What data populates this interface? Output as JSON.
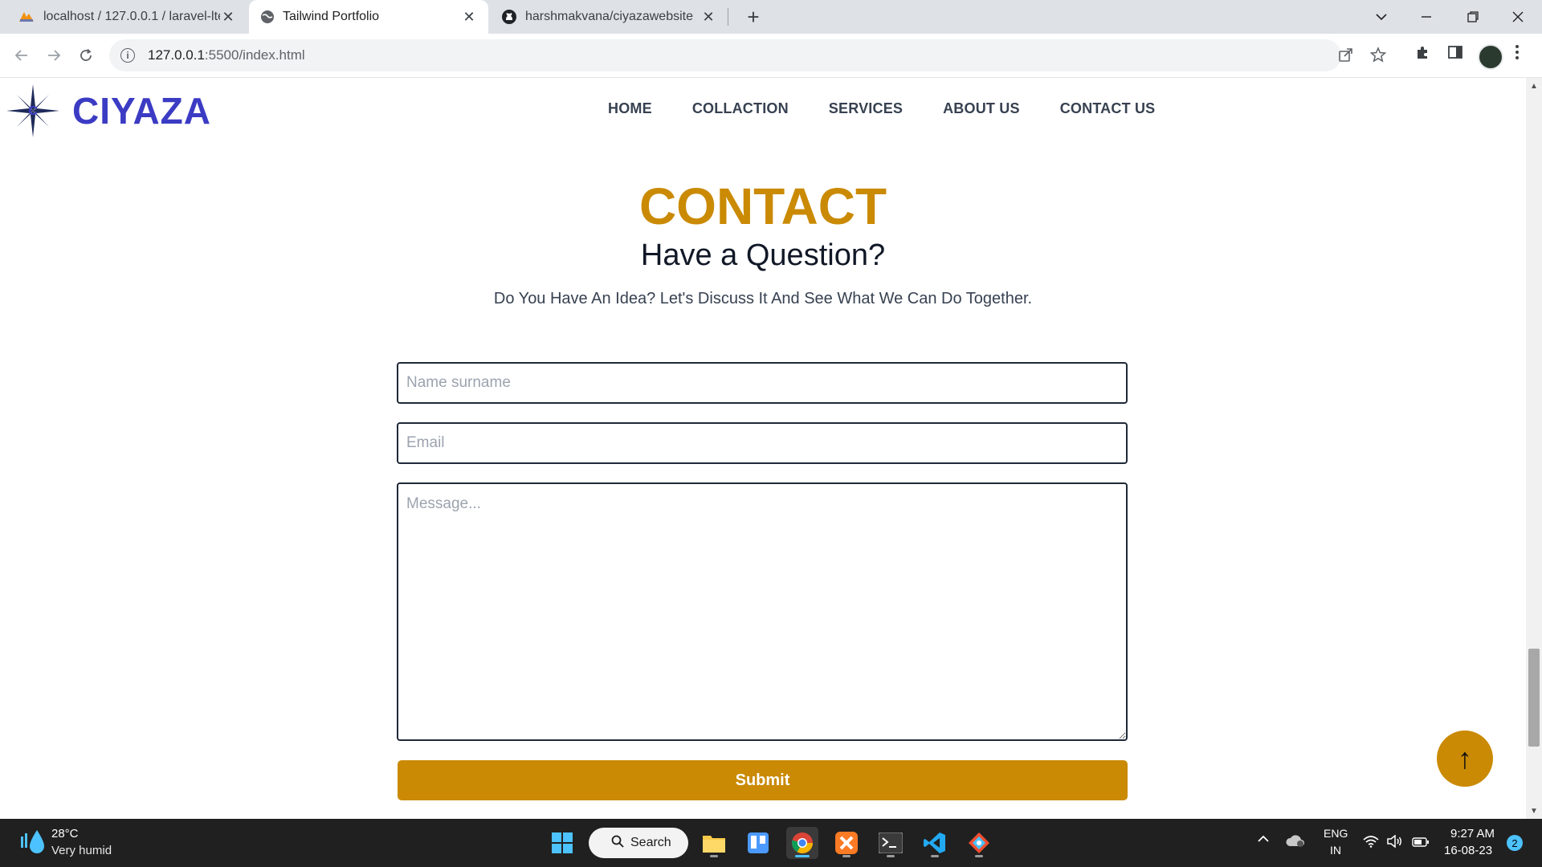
{
  "browser": {
    "tabs": [
      {
        "title": "localhost / 127.0.0.1 / laravel-lte",
        "icon": "phpmyadmin-icon"
      },
      {
        "title": "Tailwind Portfolio",
        "icon": "globe-icon",
        "active": true
      },
      {
        "title": "harshmakvana/ciyazawebsite",
        "icon": "github-icon"
      }
    ],
    "close_glyph": "✕",
    "new_tab_glyph": "+",
    "url_host": "127.0.0.1",
    "url_rest": ":5500/index.html"
  },
  "site": {
    "logo_text": "CIYAZA",
    "nav": [
      "HOME",
      "COLLACTION",
      "SERVICES",
      "ABOUT US",
      "CONTACT US"
    ]
  },
  "contact": {
    "title": "CONTACT",
    "subtitle": "Have a Question?",
    "description": "Do You Have An Idea? Let's Discuss It And See What We Can Do Together.",
    "name_placeholder": "Name surname",
    "email_placeholder": "Email",
    "message_placeholder": "Message...",
    "submit_label": "Submit",
    "to_top_glyph": "↑"
  },
  "colors": {
    "accent": "#ca8a04",
    "logo": "#3b3bc4"
  },
  "taskbar": {
    "temperature": "28°C",
    "weather": "Very humid",
    "search_label": "Search",
    "lang_line1": "ENG",
    "lang_line2": "IN",
    "time": "9:27 AM",
    "date": "16-08-23",
    "notification_count": "2"
  }
}
